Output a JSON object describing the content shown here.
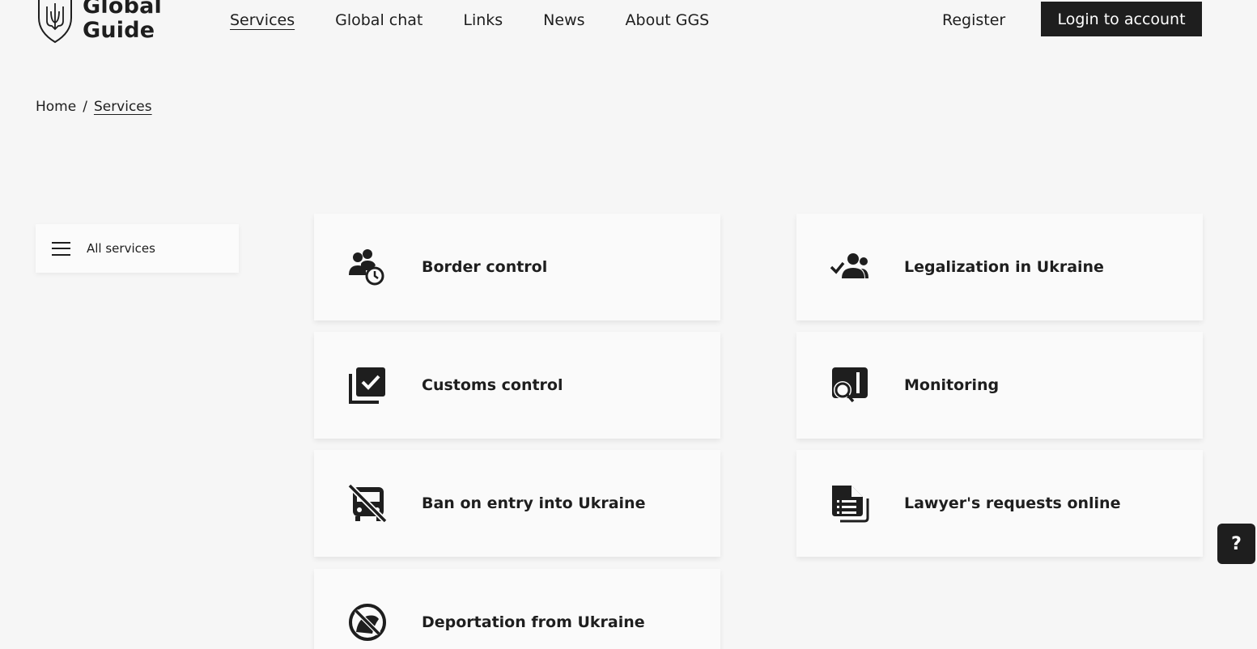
{
  "header": {
    "logo_line1": "Global",
    "logo_line2": "Guide",
    "nav": [
      {
        "label": "Services",
        "active": true
      },
      {
        "label": "Global chat"
      },
      {
        "label": "Links"
      },
      {
        "label": "News"
      },
      {
        "label": "About GGS"
      }
    ],
    "register_label": "Register",
    "login_label": "Login to account"
  },
  "breadcrumb": {
    "home": "Home",
    "separator": "/",
    "current": "Services"
  },
  "sidebar": {
    "all_services_label": "All services"
  },
  "services": [
    {
      "title": "Border control",
      "icon": "people-clock-icon"
    },
    {
      "title": "Legalization in Ukraine",
      "icon": "people-check-icon"
    },
    {
      "title": "Customs control",
      "icon": "checklist-icon"
    },
    {
      "title": "Monitoring",
      "icon": "search-document-icon"
    },
    {
      "title": "Ban on entry into Ukraine",
      "icon": "no-bus-icon"
    },
    {
      "title": "Lawyer's requests online",
      "icon": "documents-icon"
    },
    {
      "title": "Deportation from Ukraine",
      "icon": "no-entry-icon"
    }
  ],
  "help": {
    "label": "?"
  },
  "colors": {
    "primary": "#1e1e1e",
    "background": "#f6f6f6",
    "card": "#fafafa"
  }
}
